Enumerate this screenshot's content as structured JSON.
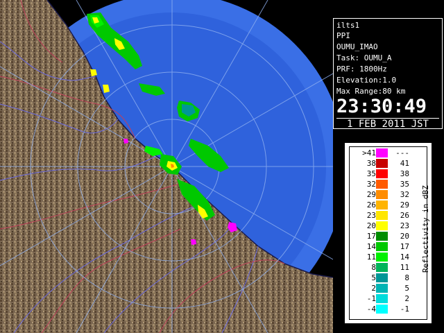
{
  "info": {
    "station": "ilts1",
    "product": "PPI",
    "site": "OUMU_IMAO",
    "task": "Task: OUMU_A",
    "prf": "PRF: 1800Hz",
    "elevation": "Elevation:1.0",
    "max_range": "Max Range:80 km",
    "time": "23:30:49",
    "date": "1 FEB 2011 JST"
  },
  "legend": {
    "title": "Reflectivity in dBZ",
    "rows": [
      {
        "lo": ">41",
        "hi": "---",
        "color": "#ff00ff"
      },
      {
        "lo": "38",
        "hi": "41",
        "color": "#c80000"
      },
      {
        "lo": "35",
        "hi": "38",
        "color": "#ff0000"
      },
      {
        "lo": "32",
        "hi": "35",
        "color": "#ff5a00"
      },
      {
        "lo": "29",
        "hi": "32",
        "color": "#ff8c00"
      },
      {
        "lo": "26",
        "hi": "29",
        "color": "#ffb400"
      },
      {
        "lo": "23",
        "hi": "26",
        "color": "#ffe600"
      },
      {
        "lo": "20",
        "hi": "23",
        "color": "#ffff00"
      },
      {
        "lo": "17",
        "hi": "20",
        "color": "#008c00"
      },
      {
        "lo": "14",
        "hi": "17",
        "color": "#00c800"
      },
      {
        "lo": "11",
        "hi": "14",
        "color": "#00f000"
      },
      {
        "lo": "8",
        "hi": "11",
        "color": "#00b45a"
      },
      {
        "lo": "5",
        "hi": "8",
        "color": "#009696"
      },
      {
        "lo": "2",
        "hi": "5",
        "color": "#00b4b4"
      },
      {
        "lo": "-1",
        "hi": "2",
        "color": "#00dcdc"
      },
      {
        "lo": "-4",
        "hi": "-1",
        "color": "#00ffff"
      }
    ]
  },
  "colors": {
    "radar_disc": "#3a6fe6",
    "radar_disc_inner": "#2f62dc",
    "range_ring": "#8fb0f0",
    "land": "#7a6650",
    "coast_line": "#1a1a4a",
    "river": "#6a6ae0",
    "border": "#c0405a"
  }
}
